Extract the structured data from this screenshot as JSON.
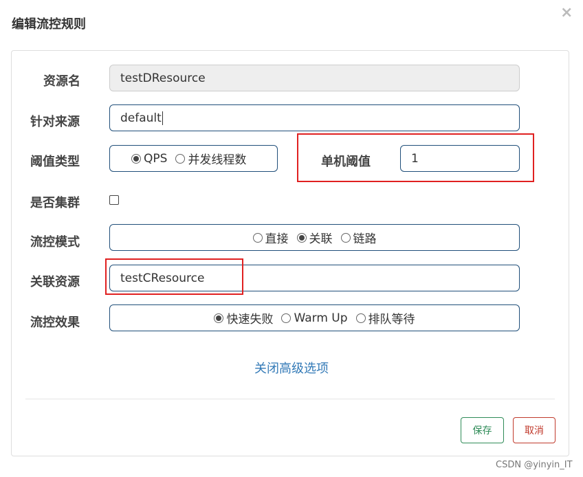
{
  "dialog": {
    "title": "编辑流控规则",
    "close": "×"
  },
  "form": {
    "resource_name": {
      "label": "资源名",
      "value": "testDResource"
    },
    "limit_app": {
      "label": "针对来源",
      "value": "default"
    },
    "threshold_type": {
      "label": "阈值类型",
      "options": [
        "QPS",
        "并发线程数"
      ],
      "selected": "QPS"
    },
    "single_threshold": {
      "label": "单机阈值",
      "value": "1"
    },
    "cluster": {
      "label": "是否集群",
      "checked": false
    },
    "flow_mode": {
      "label": "流控模式",
      "options": [
        "直接",
        "关联",
        "链路"
      ],
      "selected": "关联"
    },
    "ref_resource": {
      "label": "关联资源",
      "value": "testCResource"
    },
    "control_effect": {
      "label": "流控效果",
      "options": [
        "快速失败",
        "Warm Up",
        "排队等待"
      ],
      "selected": "快速失败"
    }
  },
  "advanced_link": "关闭高级选项",
  "buttons": {
    "save": "保存",
    "cancel": "取消"
  },
  "watermark": "CSDN @yinyin_IT",
  "colors": {
    "field_border": "#1f4e79",
    "highlight": "#e02020",
    "link": "#337ab7",
    "save": "#2e8b57",
    "cancel": "#c0392b"
  }
}
